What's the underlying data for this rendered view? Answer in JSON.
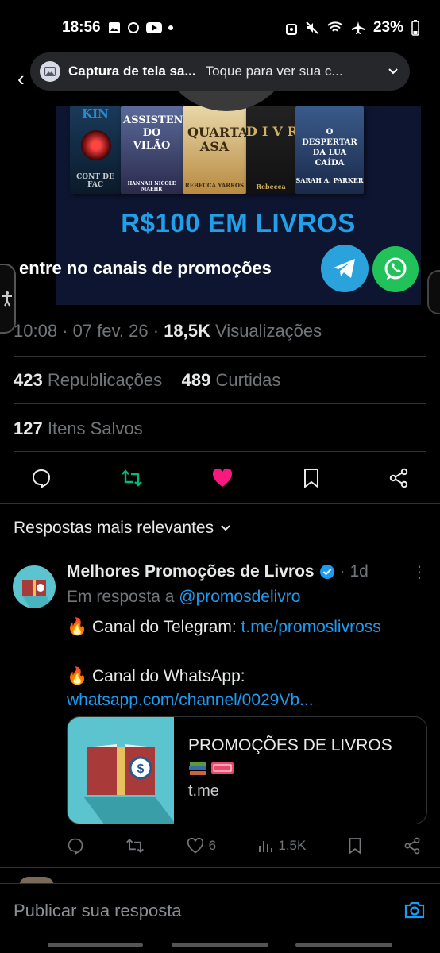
{
  "status_bar": {
    "time": "18:56",
    "battery": "23%"
  },
  "notification": {
    "title": "Captura de tela sa...",
    "text": "Toque para ver sua c..."
  },
  "banner": {
    "books": [
      "KIN",
      "ASSISTENTE DO VILÃO",
      "QUARTA ASA",
      "DIVR",
      "O DESPERTAR DA LUA CAÍDA"
    ],
    "book_credits": [
      "CONT DE FAC",
      "HANNAH NICOLE MAEHR",
      "REBECCA YARROS",
      "Rebecca",
      "SARAH A. PARKER"
    ],
    "headline": "R$100 EM LIVROS",
    "subline": "entre no canais de promoções"
  },
  "post_meta": {
    "time": "10:08",
    "date": "07 fev. 26",
    "views_count": "18,5K",
    "views_label": "Visualizações",
    "reposts_count": "423",
    "reposts_label": "Republicações",
    "likes_count": "489",
    "likes_label": "Curtidas",
    "bookmarks_count": "127",
    "bookmarks_label": "Itens Salvos"
  },
  "replies_sort": {
    "label": "Respostas mais relevantes"
  },
  "reply": {
    "author": "Melhores Promoções de Livros",
    "time": "1d",
    "in_reply_prefix": "Em resposta a",
    "in_reply_handle": "@promosdelivro",
    "line1_prefix": "🔥 Canal do Telegram: ",
    "line1_link": "t.me/promoslivross",
    "line2_prefix": "🔥 Canal do WhatsApp: ",
    "line2_link": "whatsapp.com/channel/0029Vb...",
    "card": {
      "title": "PROMOÇÕES DE LIVROS",
      "domain": "t.me"
    },
    "actions": {
      "likes": "6",
      "views": "1,5K"
    }
  },
  "composer": {
    "placeholder": "Publicar sua resposta"
  },
  "colors": {
    "accent_blue": "#1d9bf0",
    "repost_green": "#00ba7c",
    "like_pink": "#f91880",
    "telegram": "#2aa3dd",
    "whatsapp": "#22c25b"
  }
}
